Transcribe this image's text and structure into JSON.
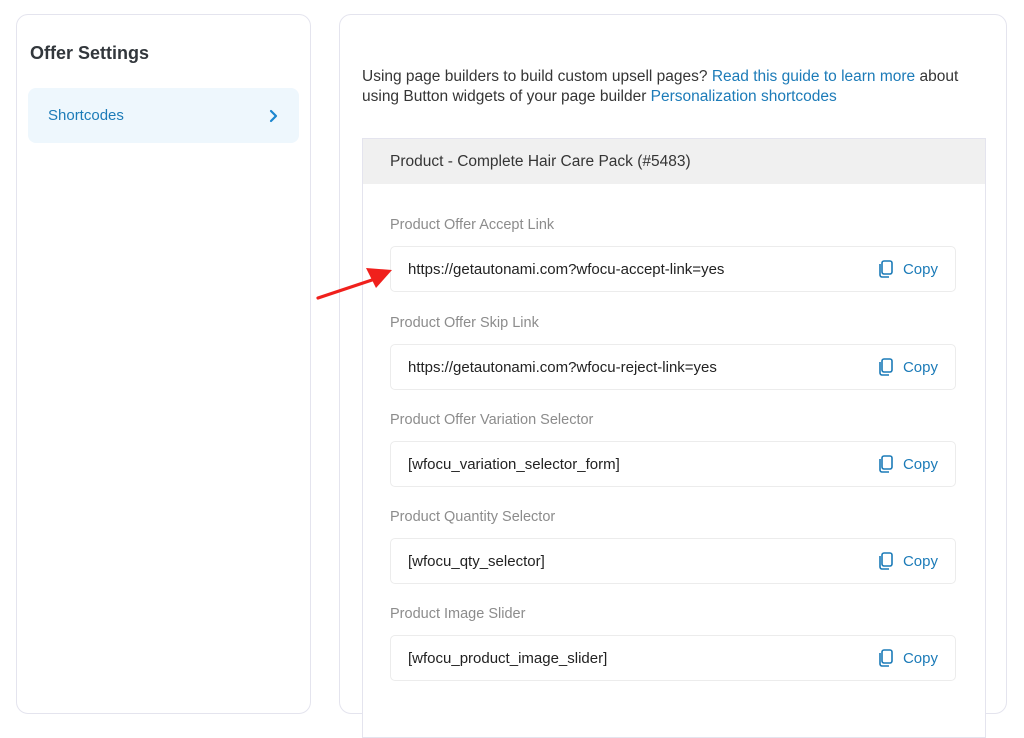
{
  "sidebar": {
    "title": "Offer Settings",
    "items": [
      {
        "label": "Shortcodes",
        "icon": "chevron-right-icon",
        "active": true
      }
    ]
  },
  "main": {
    "intro": {
      "text1": "Using page builders to build custom upsell pages? ",
      "link1": "Read this guide to learn more",
      "text2": " about using Button widgets of your page builder ",
      "link2": "Personalization shortcodes"
    },
    "product": {
      "header": "Product - Complete Hair Care Pack (#5483)",
      "fields": [
        {
          "label": "Product Offer Accept Link",
          "value": "https://getautonami.com?wfocu-accept-link=yes",
          "copy_label": "Copy"
        },
        {
          "label": "Product Offer Skip Link",
          "value": "https://getautonami.com?wfocu-reject-link=yes",
          "copy_label": "Copy"
        },
        {
          "label": "Product Offer Variation Selector",
          "value": "[wfocu_variation_selector_form]",
          "copy_label": "Copy"
        },
        {
          "label": "Product Quantity Selector",
          "value": "[wfocu_qty_selector]",
          "copy_label": "Copy"
        },
        {
          "label": "Product Image Slider",
          "value": "[wfocu_product_image_slider]",
          "copy_label": "Copy"
        }
      ]
    }
  },
  "annotation": {
    "icon": "red-arrow-icon",
    "color": "#f0201c"
  },
  "colors": {
    "accent": "#1c7bb8",
    "active_bg": "#eef7fd",
    "header_bg": "#f0f0f0"
  }
}
